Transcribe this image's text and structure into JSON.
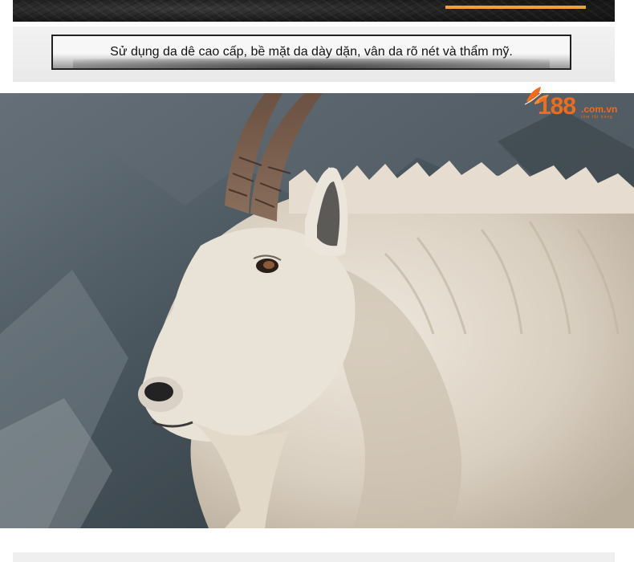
{
  "caption": {
    "text": "Sử dụng da dê cao cấp, bề mặt da dày dặn, vân da rõ nét và thẩm mỹ."
  },
  "logo": {
    "number": "188",
    "domain": ".com.vn",
    "tagline": "tóm tắt hàng",
    "icon": "leaf-icon",
    "color": "#f06b1a"
  },
  "photo": {
    "subject": "mountain-goat-photo"
  },
  "colors": {
    "accent_bar": "#f0a23a",
    "banner_dark": "#1c1c1c",
    "panel_bg": "#efefef"
  }
}
